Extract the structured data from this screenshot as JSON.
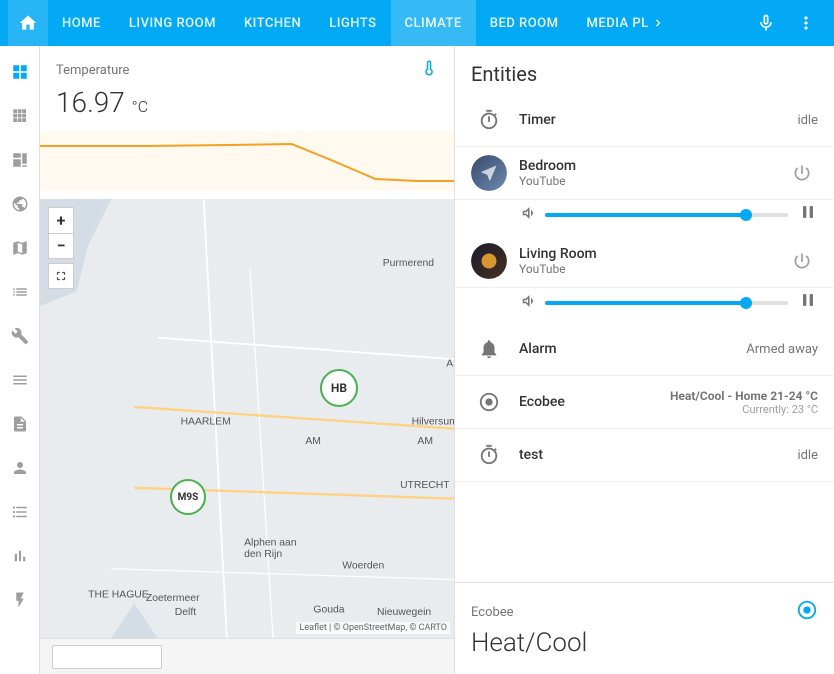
{
  "nav": {
    "items": [
      {
        "label": "HOME",
        "active": false
      },
      {
        "label": "LIVING ROOM",
        "active": false
      },
      {
        "label": "KITCHEN",
        "active": false
      },
      {
        "label": "LIGHTS",
        "active": false
      },
      {
        "label": "CLIMATE",
        "active": true
      },
      {
        "label": "BED ROOM",
        "active": false
      },
      {
        "label": "MEDIA PL",
        "active": false
      }
    ]
  },
  "sidebar": {
    "icons": [
      {
        "name": "grid-icon",
        "symbol": "⊞",
        "active": true
      },
      {
        "name": "grid2-icon",
        "symbol": "▦",
        "active": false
      },
      {
        "name": "dashboard-icon",
        "symbol": "◫",
        "active": false
      },
      {
        "name": "globe-icon",
        "symbol": "🌐",
        "active": false
      },
      {
        "name": "map-icon",
        "symbol": "◱",
        "active": false
      },
      {
        "name": "list-icon",
        "symbol": "≡",
        "active": false
      },
      {
        "name": "tools-icon",
        "symbol": "⚙",
        "active": false
      },
      {
        "name": "menu2-icon",
        "symbol": "☰",
        "active": false
      },
      {
        "name": "file-icon",
        "symbol": "◫",
        "active": false
      },
      {
        "name": "person-icon",
        "symbol": "👤",
        "active": false
      },
      {
        "name": "listdots-icon",
        "symbol": "≡",
        "active": false
      },
      {
        "name": "chart-icon",
        "symbol": "▦",
        "active": false
      },
      {
        "name": "lightning-icon",
        "symbol": "⚡",
        "active": false
      }
    ]
  },
  "temperature": {
    "label": "Temperature",
    "value": "16.97",
    "unit": "°C"
  },
  "map": {
    "zoom_in": "+",
    "zoom_out": "−",
    "marker1_label": "HB",
    "marker2_label": "M9S",
    "attribution": "Leaflet | © OpenStreetMap, © CARTO",
    "city_labels": [
      "HAARLEM",
      "Purmerend",
      "THE HAGUE",
      "UTRECHT",
      "Hilversum",
      "Alphen aan den Rijn",
      "Zoetermeer",
      "Woerden",
      "Nieuwegein",
      "Gouda",
      "Delft",
      "Alme"
    ]
  },
  "entities": {
    "title": "Entities",
    "items": [
      {
        "type": "timer",
        "name": "Timer",
        "status": "idle",
        "has_volume": false
      },
      {
        "type": "media",
        "name": "Bedroom",
        "sub": "YouTube",
        "has_volume": true,
        "volume_pct": 85
      },
      {
        "type": "media",
        "name": "Living Room",
        "sub": "YouTube",
        "has_volume": true,
        "volume_pct": 85
      },
      {
        "type": "alarm",
        "name": "Alarm",
        "status": "Armed away",
        "has_volume": false
      },
      {
        "type": "ecobee",
        "name": "Ecobee",
        "status": "Heat/Cool - Home 21-24 °C",
        "status2": "Currently: 23 °C",
        "has_volume": false
      },
      {
        "type": "timer",
        "name": "test",
        "status": "idle",
        "has_volume": false
      }
    ]
  },
  "ecobee_card": {
    "label": "Ecobee",
    "mode": "Heat/Cool"
  },
  "bottom": {
    "input_placeholder": ""
  }
}
